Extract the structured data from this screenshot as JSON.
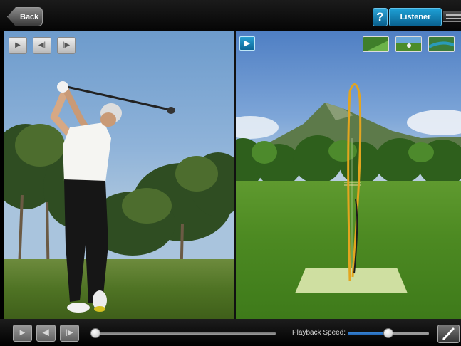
{
  "topbar": {
    "back_label": "Back",
    "help_label": "?",
    "listener_label": "Listener"
  },
  "left_panel": {
    "controls": [
      {
        "name": "play",
        "glyph": "▶"
      },
      {
        "name": "step-back",
        "glyph": "◀|"
      },
      {
        "name": "step-forward",
        "glyph": "|▶"
      }
    ]
  },
  "right_panel": {
    "play_glyph": "▶",
    "views": [
      "down-the-line-view",
      "face-on-view",
      "overhead-view"
    ]
  },
  "bottombar": {
    "controls": [
      {
        "name": "play",
        "glyph": "▶"
      },
      {
        "name": "step-back",
        "glyph": "◀|"
      },
      {
        "name": "step-forward",
        "glyph": "|▶"
      }
    ],
    "timeline_position": 0.0,
    "playback_speed_label": "Playback Speed:",
    "playback_speed": 0.5
  },
  "colors": {
    "accent": "#1a8fc6",
    "trace": "#e3a51f"
  }
}
